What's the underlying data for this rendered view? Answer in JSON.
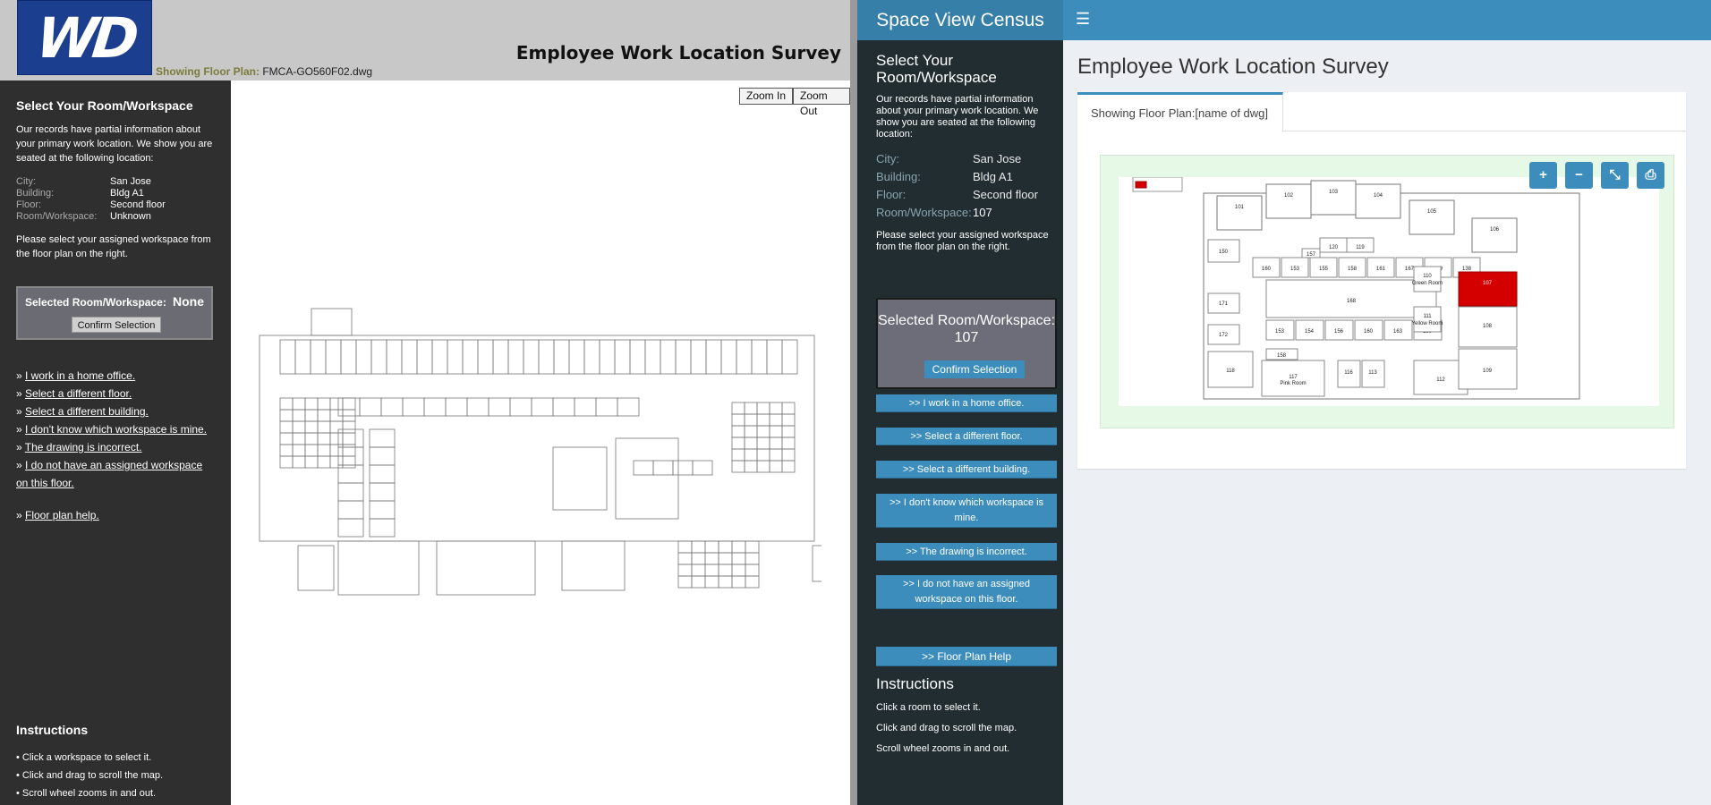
{
  "left": {
    "logo_text": "WD",
    "floorplan_label": "Showing Floor Plan:",
    "floorplan_value": "FMCA-GO560F02.dwg",
    "title": "Employee Work Location Survey",
    "zoom_in": "Zoom In",
    "zoom_out": "Zoom Out",
    "sidebar": {
      "heading": "Select Your Room/Workspace",
      "intro": "Our records have partial information about your primary work location. We show you are seated at the following location:",
      "fields": [
        {
          "key": "City:",
          "value": "San Jose"
        },
        {
          "key": "Building:",
          "value": "Bldg A1"
        },
        {
          "key": "Floor:",
          "value": "Second floor"
        },
        {
          "key": "Room/Workspace:",
          "value": "Unknown"
        }
      ],
      "select_note": "Please select your assigned workspace from the floor plan on the right.",
      "selected_label": "Selected Room/Workspace:",
      "selected_value": "None",
      "confirm": "Confirm Selection",
      "links": [
        "I work in a home office.",
        "Select a different floor.",
        "Select a different building.",
        "I don't know which workspace is mine.",
        "The drawing is incorrect.",
        "I do not have an assigned workspace",
        "on this floor.",
        "Floor plan help."
      ],
      "instructions_heading": "Instructions",
      "instructions": [
        "• Click a workspace to select it.",
        "• Click and drag to scroll the map.",
        "• Scroll wheel zooms in and out."
      ]
    }
  },
  "right": {
    "brand": "Space View Census",
    "menu_icon": "hamburger-icon",
    "sidebar": {
      "heading": "Select Your Room/Workspace",
      "intro": "Our records have partial information about your primary work location. We show you are seated at the following location:",
      "fields": [
        {
          "key": "City:",
          "value": "San Jose"
        },
        {
          "key": "Building:",
          "value": "Bldg A1"
        },
        {
          "key": "Floor:",
          "value": "Second floor"
        },
        {
          "key": "Room/Workspace:",
          "value": "107"
        }
      ],
      "select_note": "Please select your assigned workspace from the floor plan on the right.",
      "selected_text": "Selected Room/Workspace: 107",
      "confirm": "Confirm Selection",
      "buttons": [
        ">> I work in a home office.",
        ">> Select a different floor.",
        ">> Select a different building.",
        ">> I don't know which workspace is mine.",
        ">> The drawing is incorrect.",
        ">> I do not have an assigned workspace on this floor.",
        ">> Floor Plan Help"
      ],
      "instructions_heading": "Instructions",
      "instructions": [
        "Click a room to select it.",
        "Click and drag to scroll the map.",
        "Scroll wheel zooms in and out."
      ]
    },
    "title": "Employee Work Location Survey",
    "tab": "Showing Floor Plan:[name of dwg]",
    "map_buttons": [
      "+",
      "−",
      "⤡",
      "⎙"
    ],
    "plan_labels": {
      "rooms": [
        "101",
        "102",
        "103",
        "104",
        "105",
        "106",
        "107",
        "108",
        "109",
        "110",
        "111",
        "112",
        "113",
        "116",
        "117",
        "118",
        "119",
        "120",
        "129",
        "130",
        "131",
        "150",
        "151",
        "152",
        "153",
        "154",
        "155",
        "156",
        "157",
        "158",
        "159",
        "160",
        "161",
        "162",
        "163",
        "167",
        "168",
        "171",
        "172"
      ],
      "green": "Green Room",
      "yellow": "Yellow Room",
      "pink": "Pink Room",
      "highlight": "107"
    }
  }
}
